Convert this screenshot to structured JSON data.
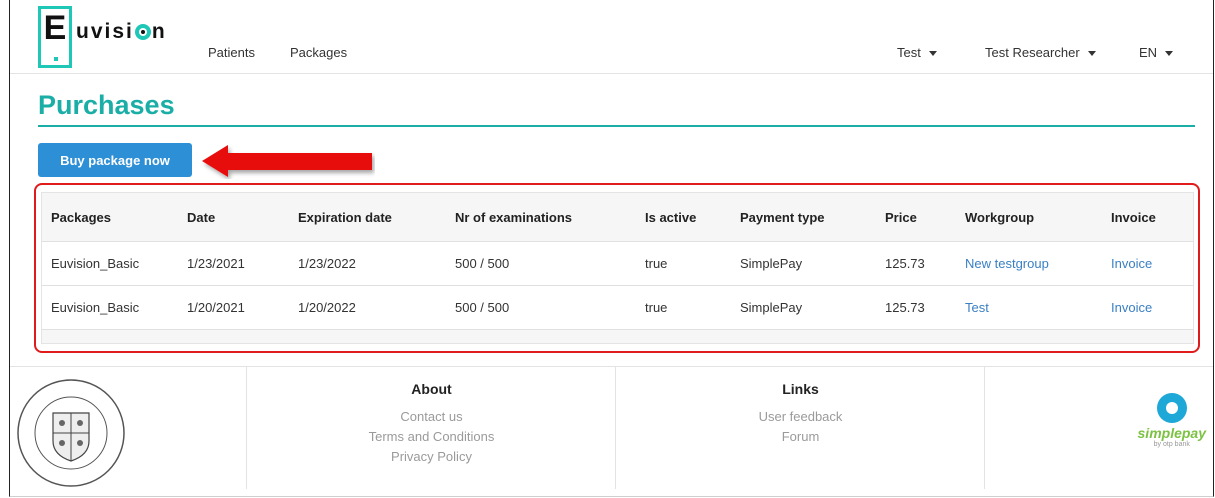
{
  "nav": {
    "logo_letter": "E",
    "logo_text_a": "uvisi",
    "logo_text_b": "n",
    "links": [
      "Patients",
      "Packages"
    ],
    "dropdowns": [
      "Test",
      "Test Researcher",
      "EN"
    ]
  },
  "page": {
    "title": "Purchases",
    "buy_button": "Buy package now"
  },
  "table": {
    "headers": [
      "Packages",
      "Date",
      "Expiration date",
      "Nr of examinations",
      "Is active",
      "Payment type",
      "Price",
      "Workgroup",
      "Invoice"
    ],
    "rows": [
      [
        "Euvision_Basic",
        "1/23/2021",
        "1/23/2022",
        "500 / 500",
        "true",
        "SimplePay",
        "125.73",
        "New testgroup",
        "Invoice"
      ],
      [
        "Euvision_Basic",
        "1/20/2021",
        "1/20/2022",
        "500 / 500",
        "true",
        "SimplePay",
        "125.73",
        "Test",
        "Invoice"
      ]
    ]
  },
  "footer": {
    "about_title": "About",
    "about_links": [
      "Contact us",
      "Terms and Conditions",
      "Privacy Policy"
    ],
    "links_title": "Links",
    "links_links": [
      "User feedback",
      "Forum"
    ],
    "simplepay_text": "simplepay",
    "simplepay_sub": "by otp bank"
  },
  "colors": {
    "accent": "#1aaea6",
    "button": "#2d8fd5",
    "highlight": "#e01b1b",
    "link": "#3a7fc4"
  }
}
